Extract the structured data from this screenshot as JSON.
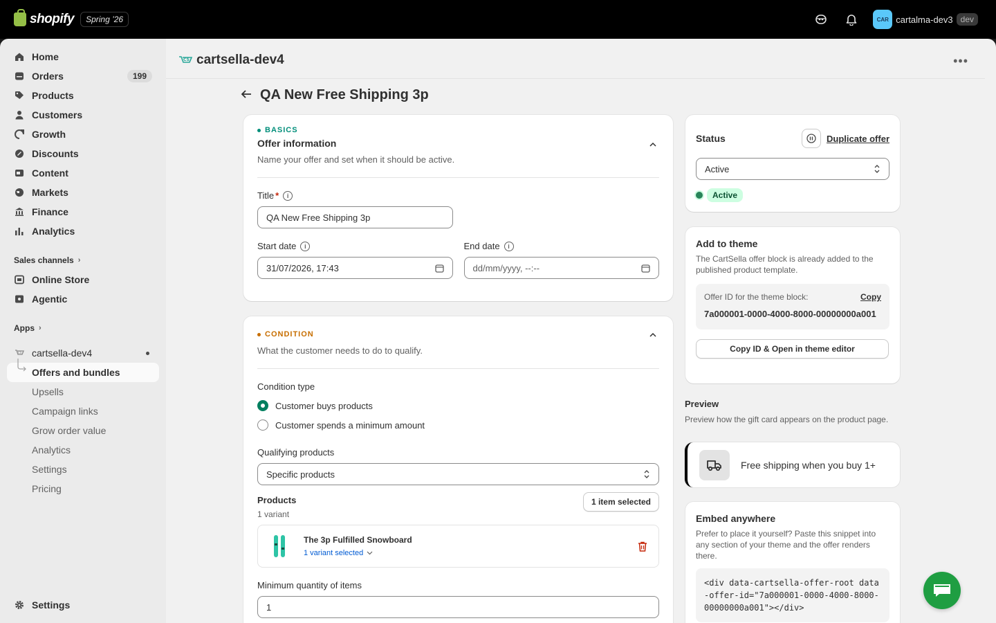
{
  "topbar": {
    "brand": "shopify",
    "season": "Spring ’26",
    "avatar_initials": "CAR",
    "store_name": "cartalma-dev3",
    "store_badge": "dev"
  },
  "sidebar": {
    "items": [
      {
        "label": "Home",
        "icon": "home-icon"
      },
      {
        "label": "Orders",
        "icon": "orders-icon",
        "count": "199"
      },
      {
        "label": "Products",
        "icon": "tag-icon"
      },
      {
        "label": "Customers",
        "icon": "person-icon"
      },
      {
        "label": "Growth",
        "icon": "growth-icon"
      },
      {
        "label": "Discounts",
        "icon": "discount-icon"
      },
      {
        "label": "Content",
        "icon": "content-icon"
      },
      {
        "label": "Markets",
        "icon": "globe-icon"
      },
      {
        "label": "Finance",
        "icon": "bank-icon"
      },
      {
        "label": "Analytics",
        "icon": "chart-icon"
      }
    ],
    "sales_channels_label": "Sales channels",
    "channels": [
      {
        "label": "Online Store",
        "icon": "store-icon"
      },
      {
        "label": "Agentic",
        "icon": "agentic-icon"
      }
    ],
    "apps_label": "Apps",
    "app_name": "cartsella-dev4",
    "app_subitems": [
      "Offers and bundles",
      "Upsells",
      "Campaign links",
      "Grow order value",
      "Analytics",
      "Settings",
      "Pricing"
    ],
    "settings_label": "Settings"
  },
  "header": {
    "app_title": "cartsella-dev4",
    "page_title": "QA New Free Shipping 3p"
  },
  "basics": {
    "eyebrow": "BASICS",
    "eyebrow_color": "#008e7a",
    "heading": "Offer information",
    "sub": "Name your offer and set when it should be active.",
    "title_label": "Title",
    "title_required": "*",
    "title_value": "QA New Free Shipping 3p",
    "start_label": "Start date",
    "start_value": "31/07/2026, 17:43",
    "end_label": "End date",
    "end_placeholder": "dd/mm/yyyy, --:--"
  },
  "condition": {
    "eyebrow": "CONDITION",
    "eyebrow_color": "#c76e00",
    "sub": "What the customer needs to do to qualify.",
    "type_label": "Condition type",
    "options": [
      "Customer buys products",
      "Customer spends a minimum amount"
    ],
    "selected_option": 0,
    "qualifying_label": "Qualifying products",
    "qualifying_value": "Specific products",
    "products_label": "Products",
    "variant_count": "1 variant",
    "selected_button": "1 item selected",
    "product_name": "The 3p Fulfilled Snowboard",
    "product_variant": "1 variant selected",
    "min_qty_label": "Minimum quantity of items",
    "min_qty_value": "1"
  },
  "status": {
    "title": "Status",
    "duplicate": "Duplicate offer",
    "select_value": "Active",
    "badge": "Active"
  },
  "theme": {
    "title": "Add to theme",
    "text": "The CartSella offer block is already added to the published product template.",
    "offer_label": "Offer ID for the theme block:",
    "copy": "Copy",
    "offer_id": "7a000001-0000-4000-8000-00000000a001",
    "button": "Copy ID & Open in theme editor"
  },
  "preview": {
    "title": "Preview",
    "text": "Preview how the gift card appears on the product page.",
    "label": "Free shipping when you buy 1+"
  },
  "embed": {
    "title": "Embed anywhere",
    "text": "Prefer to place it yourself? Paste this snippet into any section of your theme and the offer renders there.",
    "code": "<div data-cartsella-offer-root data-offer-id=\"7a000001-0000-4000-8000-00000000a001\"></div>"
  }
}
